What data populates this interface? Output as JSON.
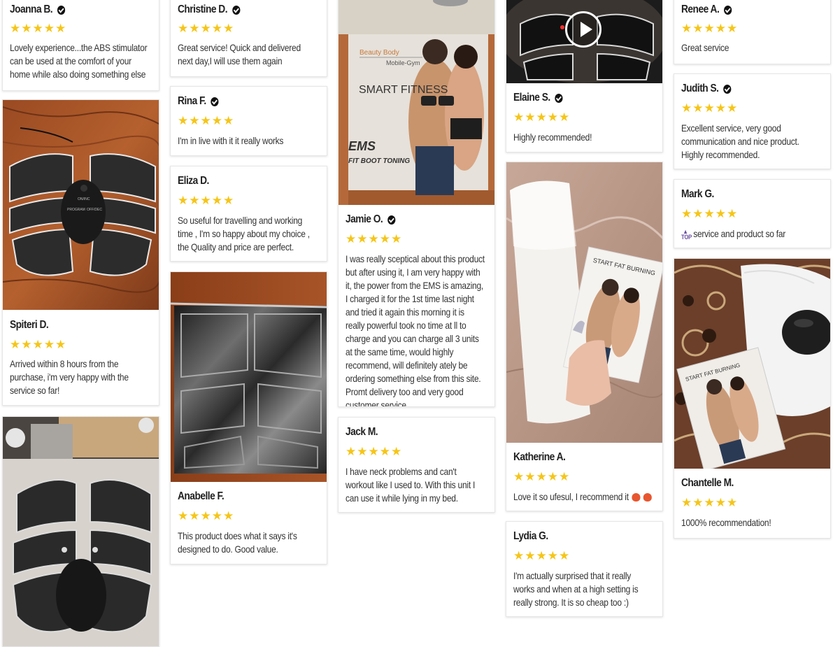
{
  "reviews": {
    "r01": {
      "name": "Joanna B.",
      "verified": true,
      "stars": "★★★★★",
      "text": "Lovely experience...the ABS stimulator can be used at the comfort of your home while also doing something else"
    },
    "r02": {
      "name": "Spiteri D.",
      "verified": false,
      "stars": "★★★★★",
      "text": "Arrived within 8 hours from the purchase, i'm very happy with the service so far!"
    },
    "r03": {
      "name": "Christine D.",
      "verified": true,
      "stars": "★★★★★",
      "text": "Great service! Quick and delivered next day,I will use them again"
    },
    "r04": {
      "name": "Rina F.",
      "verified": true,
      "stars": "★★★★★",
      "text": "I'm in live with it it really works"
    },
    "r05": {
      "name": "Eliza D.",
      "verified": false,
      "stars": "★★★★★",
      "text": "So useful for travelling and working time , I'm so happy about my choice , the Quality and price are perfect."
    },
    "r06": {
      "name": "Anabelle F.",
      "verified": false,
      "stars": "★★★★★",
      "text": "This product does what it says it's designed to do. Good value."
    },
    "r07": {
      "name": "Jamie O.",
      "verified": true,
      "stars": "★★★★★",
      "text": "I was really sceptical about this product but after using it, I am very happy with it, the power from the  EMS is amazing, I charged it for the 1st time last night and tried it again this morning it is really powerful took no time at ll to charge and you can charge all 3 units at the same time,  would highly recommend, will definitely ately be ordering something else from this site. Promt delivery too and very good customer service."
    },
    "r08": {
      "name": "Jack M.",
      "verified": false,
      "stars": "★★★★★",
      "text": "I have neck problems and can't workout like I used to. With this unit I can use it while lying in my bed."
    },
    "r09": {
      "name": "Elaine S.",
      "verified": true,
      "stars": "★★★★★",
      "text": "Highly recommended!"
    },
    "r10": {
      "name": "Katherine A.",
      "verified": false,
      "stars": "★★★★★",
      "text": "Love it so ufesul, I recommend it"
    },
    "r11": {
      "name": "Lydia G.",
      "verified": false,
      "stars": "★★★★★",
      "text": " I'm actually surprised that it really works and when at a high setting is really strong. It is so cheap too :)"
    },
    "r12": {
      "name": "Renee A.",
      "verified": true,
      "stars": "★★★★★",
      "text": "Great service"
    },
    "r13": {
      "name": "Judith S.",
      "verified": true,
      "stars": "★★★★★",
      "text": "Excellent service, very good communication and nice product. Highly recommended."
    },
    "r14": {
      "name": "Mark G.",
      "verified": false,
      "stars": "★★★★★",
      "text": "service and product so far",
      "badge": "TOP"
    },
    "r15": {
      "name": "Chantelle M.",
      "verified": false,
      "stars": "★★★★★",
      "text": "1000% recommendation!"
    }
  },
  "product_box": {
    "brand": "Beauty Body",
    "sub": "Mobile-Gym",
    "headline": "SMART FITNESS",
    "ems": "EMS",
    "tagline": "FIT BOOT TONING"
  },
  "leaflet_text": "START FAT BURNING",
  "device": {
    "label1": "PROGRAM",
    "label2": "OFF/DEC",
    "label3": "ON/INC"
  },
  "icons": {
    "verified": "check-circle-icon",
    "play": "play-icon",
    "star": "star-icon"
  }
}
